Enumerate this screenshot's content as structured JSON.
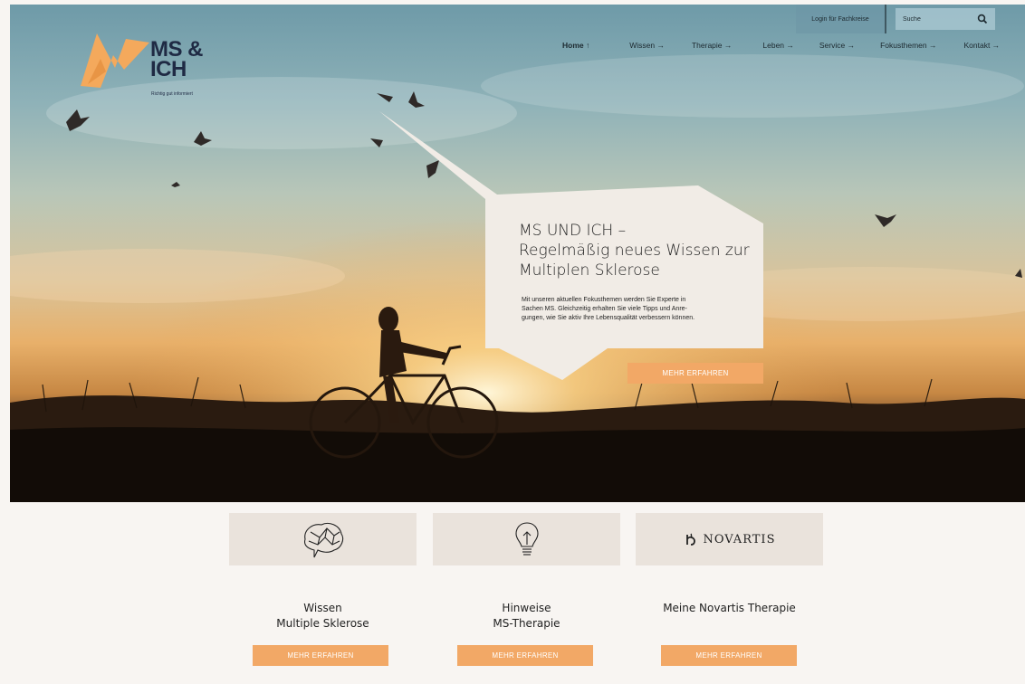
{
  "header": {
    "login_label": "Login für Fachkreise",
    "search_placeholder": "Suche",
    "logo": {
      "line1": "MS &",
      "line2": "ICH",
      "tagline": "Richtig gut informiert"
    }
  },
  "nav": {
    "items": [
      {
        "label": "Home ↑",
        "active": true
      },
      {
        "label": "Wissen →"
      },
      {
        "label": "Therapie →"
      },
      {
        "label": "Leben →"
      },
      {
        "label": "Service →"
      },
      {
        "label": "Fokusthemen →"
      },
      {
        "label": "Kontakt →"
      }
    ]
  },
  "hero": {
    "title_line1": "MS UND ICH –",
    "title_line2": "Regelmäßig neues Wissen zur",
    "title_line3": "Multiplen Sklerose",
    "text_line1": "Mit unseren aktuellen Fokusthemen werden Sie Experte in",
    "text_line2": "Sachen MS. Gleichzeitig erhalten Sie viele Tipps und Anre-",
    "text_line3": "gungen, wie Sie aktiv Ihre Lebensqualität verbessern können.",
    "cta_label": "MEHR ERFAHREN"
  },
  "cards": [
    {
      "icon": "brain-icon",
      "title_line1": "Wissen",
      "title_line2": "Multiple Sklerose",
      "cta_label": "MEHR ERFAHREN"
    },
    {
      "icon": "lightbulb-icon",
      "title_line1": "Hinweise",
      "title_line2": "MS-Therapie",
      "cta_label": "MEHR ERFAHREN"
    },
    {
      "icon": "novartis-logo",
      "logo_word": "NOVARTIS",
      "title_line1": "Meine Novartis Therapie",
      "cta_label": "MEHR ERFAHREN"
    }
  ],
  "colors": {
    "accent": "#f2a866",
    "logo_orange": "#f4a95c",
    "navy": "#1f2a44",
    "card_bg": "#eae3dc",
    "page_bg": "#f8f5f2"
  }
}
